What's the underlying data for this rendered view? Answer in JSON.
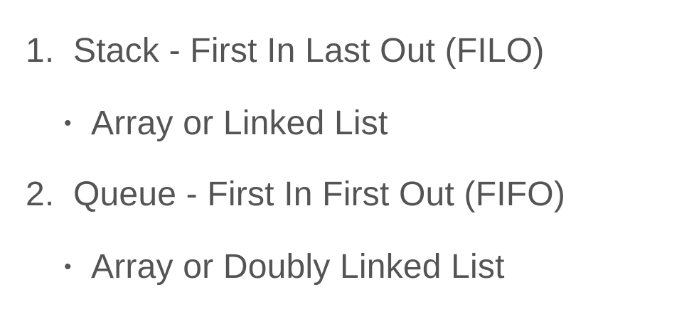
{
  "items": [
    {
      "marker": "1.",
      "text": "Stack - First In Last Out (FILO)",
      "sub": {
        "marker": "•",
        "text": "Array or Linked List"
      }
    },
    {
      "marker": "2.",
      "text": "Queue - First In First Out (FIFO)",
      "sub": {
        "marker": "•",
        "text": "Array or Doubly Linked List"
      }
    }
  ],
  "colors": {
    "text": "#545454",
    "background": "#ffffff"
  }
}
